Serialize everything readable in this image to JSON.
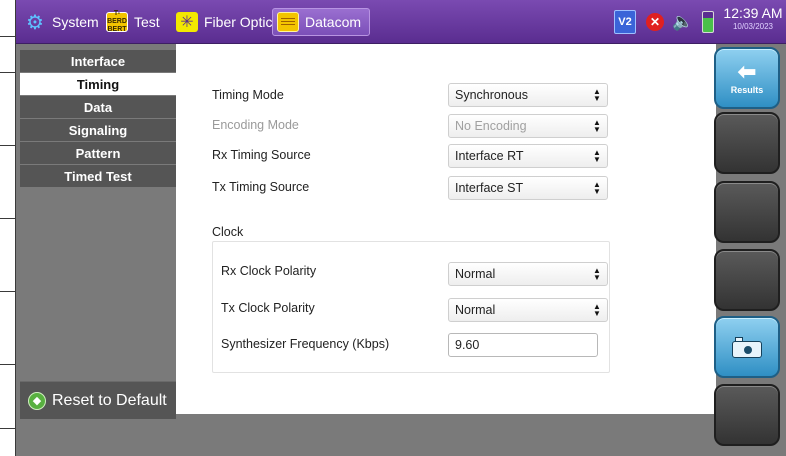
{
  "topbar": {
    "tabs": [
      {
        "label": "System",
        "icon": "gear-icon"
      },
      {
        "label": "Test",
        "icon": "bert-icon",
        "icon_text": "T-BERD BERT"
      },
      {
        "label": "Fiber Optics",
        "icon": "fiber-optics-icon"
      },
      {
        "label": "Datacom",
        "icon": "datacom-icon"
      }
    ],
    "active_tab": "Datacom",
    "status": {
      "v2_badge": "V2",
      "time": "12:39 AM",
      "date": "10/03/2023"
    }
  },
  "nav": {
    "items": [
      {
        "label": "Interface"
      },
      {
        "label": "Timing"
      },
      {
        "label": "Data"
      },
      {
        "label": "Signaling"
      },
      {
        "label": "Pattern"
      },
      {
        "label": "Timed Test"
      }
    ],
    "active": "Timing",
    "reset_label": "Reset to Default"
  },
  "form": {
    "timing_mode": {
      "label": "Timing Mode",
      "value": "Synchronous"
    },
    "encoding_mode": {
      "label": "Encoding Mode",
      "value": "No Encoding",
      "disabled": true
    },
    "rx_timing_source": {
      "label": "Rx Timing Source",
      "value": "Interface RT"
    },
    "tx_timing_source": {
      "label": "Tx Timing Source",
      "value": "Interface ST"
    },
    "clock": {
      "title": "Clock",
      "rx_clock_polarity": {
        "label": "Rx Clock Polarity",
        "value": "Normal"
      },
      "tx_clock_polarity": {
        "label": "Tx Clock Polarity",
        "value": "Normal"
      },
      "synth_freq": {
        "label": "Synthesizer Frequency  (Kbps)",
        "value": "9.60"
      }
    }
  },
  "side_buttons": {
    "results_label": "Results"
  },
  "colors": {
    "topbar": "#6a3aa3",
    "nav_bg": "#555555",
    "accent_button": "#2f8fc4"
  }
}
